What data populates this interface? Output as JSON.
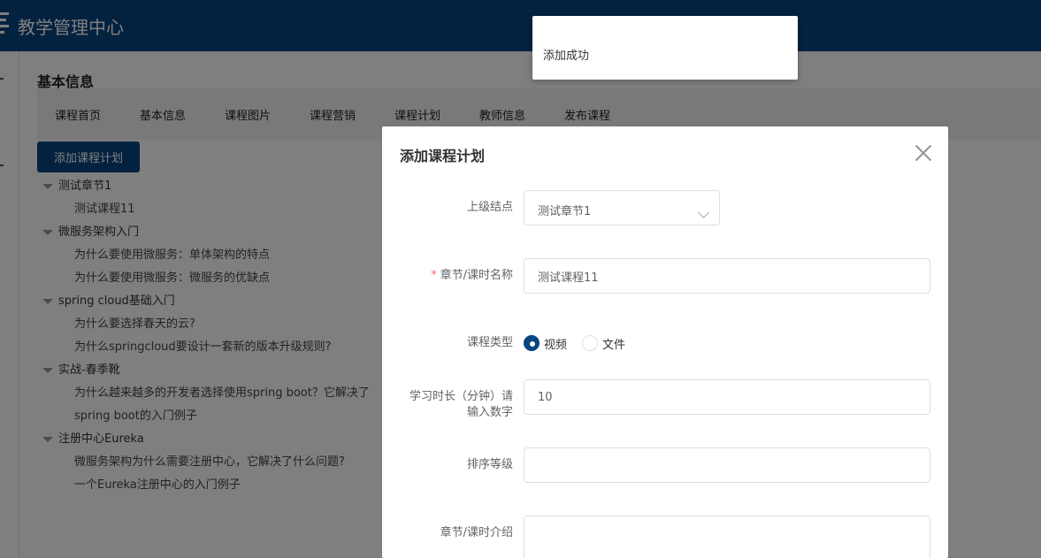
{
  "app": {
    "title": "教学管理中心"
  },
  "page": {
    "section_title": "基本信息"
  },
  "tabs": [
    {
      "label": "课程首页"
    },
    {
      "label": "基本信息"
    },
    {
      "label": "课程图片"
    },
    {
      "label": "课程营销"
    },
    {
      "label": "课程计划"
    },
    {
      "label": "教师信息"
    },
    {
      "label": "发布课程"
    }
  ],
  "active_tab": "课程计划",
  "toolbar": {
    "add_plan_label": "添加课程计划"
  },
  "tree": [
    {
      "label": "测试章节1",
      "children": [
        "测试课程11"
      ]
    },
    {
      "label": "微服务架构入门",
      "children": [
        "为什么要使用微服务：单体架构的特点",
        "为什么要使用微服务：微服务的优缺点"
      ]
    },
    {
      "label": "spring cloud基础入门",
      "children": [
        "为什么要选择春天的云?",
        "为什么springcloud要设计一套新的版本升级规则?"
      ]
    },
    {
      "label": "实战-春季靴",
      "children": [
        "为什么越来越多的开发者选择使用spring boot？它解决了",
        "spring boot的入门例子"
      ]
    },
    {
      "label": "注册中心Eureka",
      "children": [
        "微服务架构为什么需要注册中心，它解决了什么问题?",
        "一个Eureka注册中心的入门例子"
      ]
    }
  ],
  "dialog": {
    "title": "添加课程计划",
    "parent_label": "上级结点",
    "parent_value": "测试章节1",
    "name_label": "章节/课时名称",
    "name_value": "测试课程11",
    "type_label": "课程类型",
    "type_options": [
      "视频",
      "文件"
    ],
    "type_selected": "视频",
    "duration_label_line1": "学习时长（分钟）请",
    "duration_label_line2": "输入数字",
    "duration_value": "10",
    "order_label": "排序等级",
    "order_value": "",
    "intro_label": "章节/课时介绍",
    "intro_value": ""
  },
  "toast": {
    "message": "添加成功"
  },
  "colors": {
    "brand": "#07457e",
    "required": "#f56c6c"
  }
}
